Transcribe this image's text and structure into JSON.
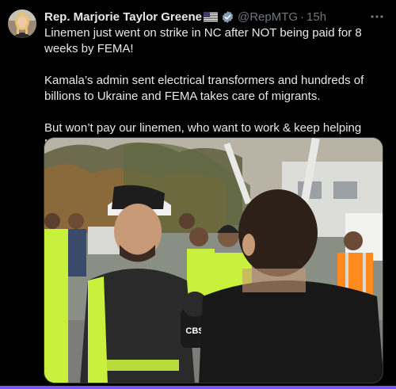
{
  "author": {
    "name": "Rep. Marjorie Taylor Greene",
    "flag_emoji": "🇺🇸",
    "verified_icon": "verified-badge-icon",
    "handle": "@RepMTG",
    "separator": "·",
    "time": "15h"
  },
  "more_icon": "more-options-icon",
  "tweet": {
    "paragraphs": [
      "Linemen just went on strike in NC after NOT being paid for 8 weeks by FEMA!",
      "Kamala’s admin sent electrical transformers and hundreds of billions to Ukraine and FEMA takes care of migrants.",
      "But won’t pay our linemen, who want to work & keep helping NC!"
    ]
  },
  "media": {
    "mic_flag_text": "CBS"
  },
  "colors": {
    "background": "#000000",
    "text": "#e7e9ea",
    "secondary": "#71767b",
    "verified": "#1d9bf0",
    "accent_bar": "#7856ff",
    "safety_vest": "#c8f03c"
  }
}
